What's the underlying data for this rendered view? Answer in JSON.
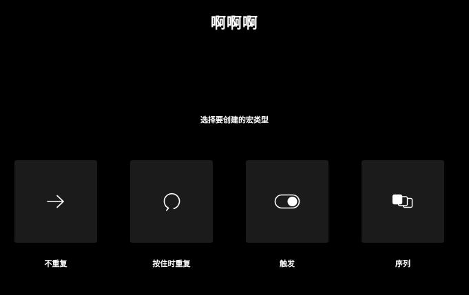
{
  "header": {
    "title": "啊啊啊",
    "prompt": "选择要创建的宏类型"
  },
  "options": [
    {
      "label": "不重复",
      "icon": "arrow-right-icon"
    },
    {
      "label": "按住时重复",
      "icon": "rotate-cw-icon"
    },
    {
      "label": "触发",
      "icon": "toggle-on-icon"
    },
    {
      "label": "序列",
      "icon": "stacked-squares-icon"
    }
  ],
  "colors": {
    "background": "#000000",
    "tile": "#1b1b1b",
    "text": "#ffffff"
  }
}
